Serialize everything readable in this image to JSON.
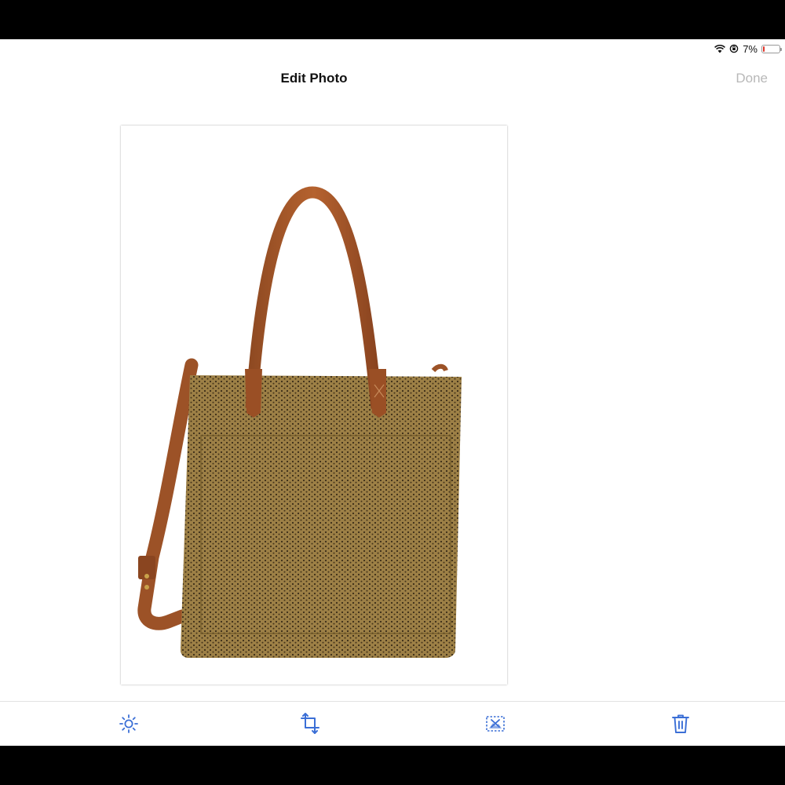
{
  "status_bar": {
    "battery_text": "7%",
    "battery_level": 0.07,
    "icons": [
      "wifi-icon",
      "orientation-lock-icon",
      "battery-icon"
    ]
  },
  "nav": {
    "title": "Edit Photo",
    "done_label": "Done"
  },
  "photo": {
    "subject": "tote-bag-image"
  },
  "toolbar": {
    "tools": [
      "brightness-icon",
      "crop-rotate-icon",
      "remove-background-icon",
      "trash-icon"
    ],
    "accent_color": "#3b6fd6"
  },
  "colors": {
    "done_disabled": "#b8b8b8",
    "battery_low": "#e0352b",
    "accent": "#3b6fd6"
  }
}
